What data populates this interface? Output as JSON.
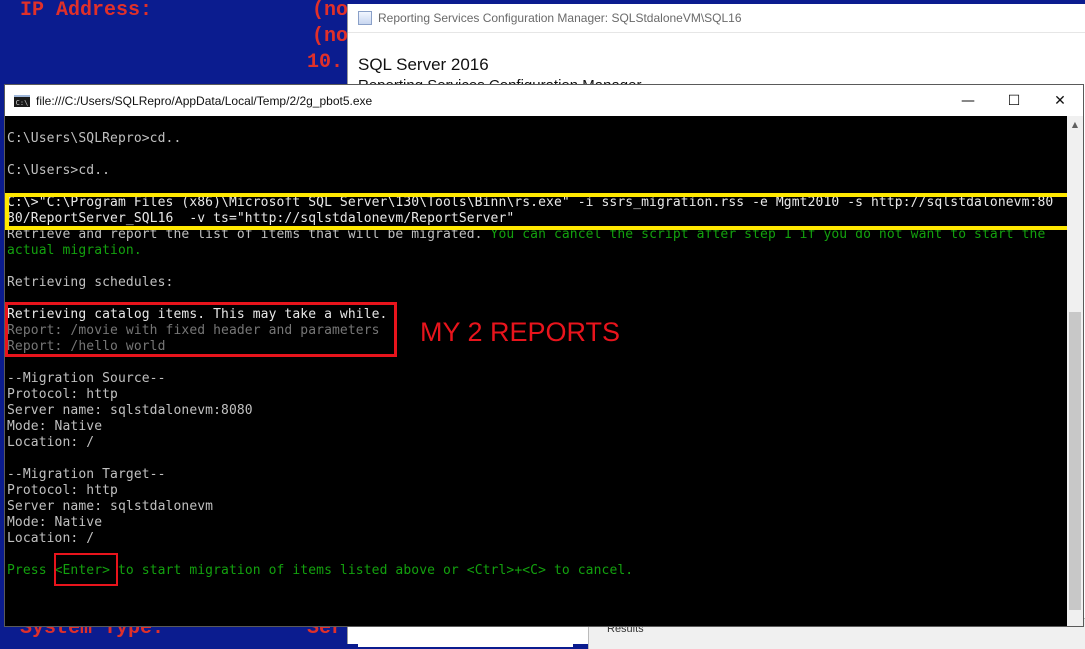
{
  "background": {
    "ip_label": "IP Address:",
    "ip_value_1": "(no",
    "ip_value_2": "(no",
    "ip_value_3": "10.",
    "system_label": "System Type:",
    "system_value": "Ser"
  },
  "rs_window": {
    "title": "Reporting Services Configuration Manager: SQLStdaloneVM\\SQL16",
    "product": "SQL Server 2016",
    "subtitle": "Reporting Services Configuration Manager",
    "results_label": "Results"
  },
  "console": {
    "title": "file:///C:/Users/SQLRepro/AppData/Local/Temp/2/2g_pbot5.exe",
    "icon_text": "C:\\",
    "minimize": "—",
    "maximize": "☐",
    "close": "✕",
    "lines": {
      "l1": "C:\\Users\\SQLRepro>cd..",
      "l2": "C:\\Users>cd..",
      "cmd1": "C:\\>\"C:\\Program Files (x86)\\Microsoft SQL Server\\130\\Tools\\Binn\\rs.exe\" -i ssrs_migration.rss -e Mgmt2010 -s http://sqlstdalonevm:80",
      "cmd2": "80/ReportServer_SQL16  -v ts=\"http://sqlstdalonevm/ReportServer\"",
      "retrieve_a": "Retrieve and report the list of items that will be migrated. ",
      "retrieve_b": "You can cancel the script after step 1 if you do not want to start the",
      "retrieve_c": "actual migration.",
      "schedules": "Retrieving schedules:",
      "catalog": "Retrieving catalog items. This may take a while.",
      "report1": "Report: /movie with fixed header and parameters",
      "report2": "Report: /hello world",
      "src_header": "--Migration Source--",
      "src_protocol": "Protocol: http",
      "src_server": "Server name: sqlstdalonevm:8080",
      "src_mode": "Mode: Native",
      "src_location": "Location: /",
      "tgt_header": "--Migration Target--",
      "tgt_protocol": "Protocol: http",
      "tgt_server": "Server name: sqlstdalonevm",
      "tgt_mode": "Mode: Native",
      "tgt_location": "Location: /",
      "press_a": "Press ",
      "press_enter": "<Enter>",
      "press_b": " to start migration of items listed above or <Ctrl>+<C> to cancel."
    }
  },
  "annotation": {
    "text": "MY 2 REPORTS",
    "color": "#e8141c"
  },
  "colors": {
    "highlight_yellow": "#ffe800",
    "highlight_red": "#e8141c",
    "console_green": "#13a10e"
  }
}
